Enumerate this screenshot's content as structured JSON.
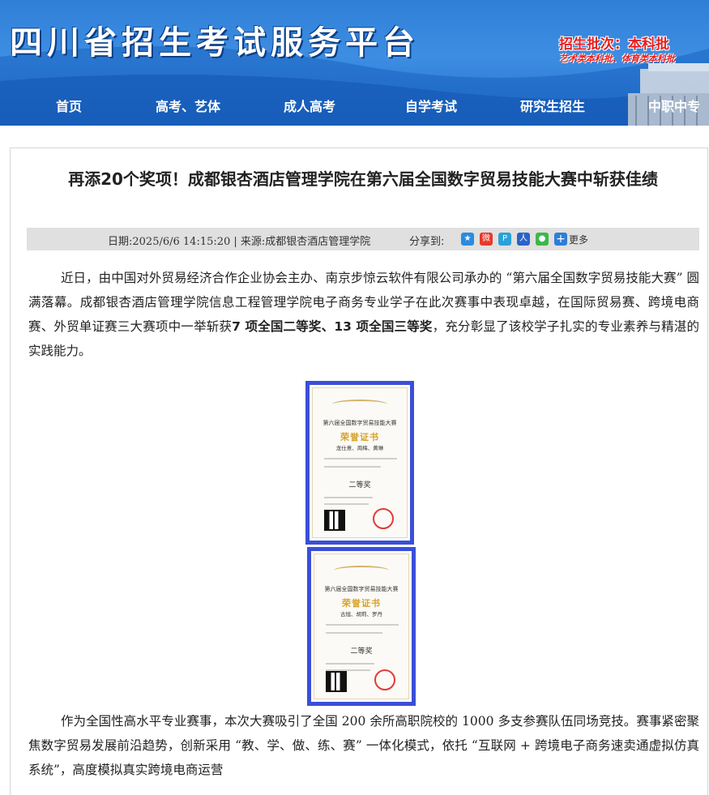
{
  "header": {
    "site_title": "四川省招生考试服务平台",
    "ad_line1": "招生批次：本科批",
    "ad_line2": "艺术类本科批、体育类本科批"
  },
  "nav": {
    "items": [
      "首页",
      "高考、艺体",
      "成人高考",
      "自学考试",
      "研究生招生",
      "中职中专"
    ]
  },
  "article": {
    "title": "再添20个奖项！成都银杏酒店管理学院在第六届全国数字贸易技能大赛中斩获佳绩",
    "meta": "日期:2025/6/6 14:15:20 | 来源:成都银杏酒店管理学院",
    "share_label": "分享到:",
    "share_more": "更多",
    "para1_a": "近日，由中国对外贸易经济合作企业协会主办、南京步惊云软件有限公司承办的 “第六届全国数字贸易技能大赛” 圆满落幕。成都银杏酒店管理学院信息工程管理学院电子商务专业学子在此次赛事中表现卓越，在国际贸易赛、跨境电商赛、外贸单证赛三大赛项中一举斩获",
    "para1_bold": "7 项全国二等奖、13 项全国三等奖",
    "para1_b": "，充分彰显了该校学子扎实的专业素养与精湛的实践能力。",
    "para2": "作为全国性高水平专业赛事，本次大赛吸引了全国 200 余所高职院校的 1000 多支参赛队伍同场竞技。赛事紧密聚焦数字贸易发展前沿趋势，创新采用 “教、学、做、练、赛” 一体化模式，依托 “互联网 + 跨境电子商务速卖通虚拟仿真系统”，高度模拟真实跨境电商运营"
  },
  "certificates": [
    {
      "heading": "第六届全国数字贸易技能大赛",
      "title": "荣誉证书",
      "names": "龙仕意、周梅、黄琳",
      "prize": "二等奖"
    },
    {
      "heading": "第六届全国数字贸易技能大赛",
      "title": "荣誉证书",
      "names": "古旭、胡莉、罗丹",
      "prize": "二等奖"
    }
  ],
  "colors": {
    "header_blue": "#2f7fd6",
    "cert_border": "#3a4fd8",
    "ad_red": "#e81e1e"
  }
}
